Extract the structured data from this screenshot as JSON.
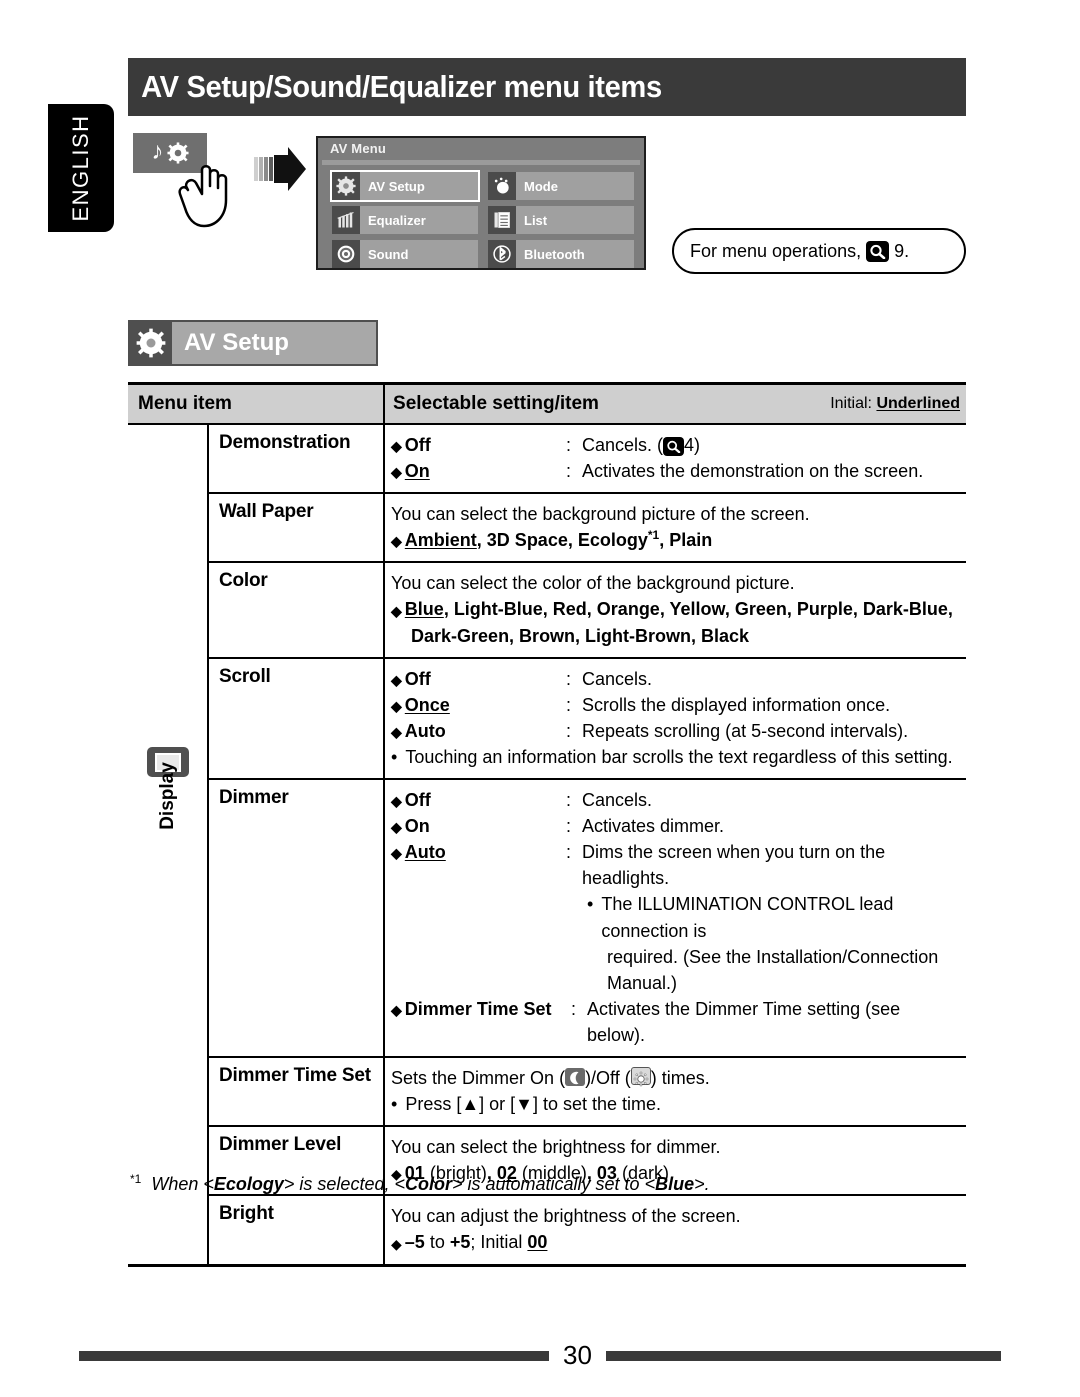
{
  "language_tab": "ENGLISH",
  "page_title": "AV Setup/Sound/Equalizer menu items",
  "source_icon": {
    "name": "music-gear-icon"
  },
  "av_menu_panel": {
    "title": "AV Menu",
    "buttons": [
      {
        "label": "AV Setup",
        "icon": "gear-icon",
        "selected": true
      },
      {
        "label": "Mode",
        "icon": "mode-icon",
        "selected": false
      },
      {
        "label": "Equalizer",
        "icon": "equalizer-icon",
        "selected": false
      },
      {
        "label": "List",
        "icon": "list-icon",
        "selected": false
      },
      {
        "label": "Sound",
        "icon": "sound-disc-icon",
        "selected": false
      },
      {
        "label": "Bluetooth",
        "icon": "bluetooth-icon",
        "selected": false
      }
    ]
  },
  "callout": {
    "text_before": "For menu operations,",
    "icon": "magnifier-icon",
    "text_after": "9."
  },
  "section": {
    "icon": "gear-icon",
    "title": "AV Setup"
  },
  "table": {
    "headers": {
      "menu_item": "Menu item",
      "selectable": "Selectable setting/item",
      "initial_prefix": "Initial:",
      "initial_underlined": "Underlined"
    },
    "category": {
      "label": "Display",
      "icon": "display-screen-icon"
    },
    "rows": [
      {
        "item": "Demonstration",
        "options": [
          {
            "name": "Off",
            "underlined": false,
            "desc_pre": "Cancels. (",
            "icon": "magnifier-icon",
            "desc_post": "4)"
          },
          {
            "name": "On",
            "underlined": true,
            "desc": "Activates the demonstration on the screen."
          }
        ]
      },
      {
        "item": "Wall Paper",
        "intro": "You can select the background picture of the screen.",
        "list_line": "Ambient, 3D Space, Ecology*1, Plain",
        "list_initial": "Ambient"
      },
      {
        "item": "Color",
        "intro": "You can select the color of the background picture.",
        "list_line_1": "Blue, Light-Blue, Red, Orange, Yellow, Green, Purple, Dark-Blue,",
        "list_line_2": "Dark-Green, Brown, Light-Brown, Black",
        "list_initial": "Blue"
      },
      {
        "item": "Scroll",
        "options": [
          {
            "name": "Off",
            "underlined": false,
            "desc": "Cancels."
          },
          {
            "name": "Once",
            "underlined": true,
            "desc": "Scrolls the displayed information once."
          },
          {
            "name": "Auto",
            "underlined": false,
            "desc": "Repeats scrolling (at 5-second intervals)."
          }
        ],
        "note": "Touching an information bar scrolls the text regardless of this setting."
      },
      {
        "item": "Dimmer",
        "options": [
          {
            "name": "Off",
            "underlined": false,
            "desc": "Cancels."
          },
          {
            "name": "On",
            "underlined": false,
            "desc": "Activates dimmer."
          },
          {
            "name": "Auto",
            "underlined": true,
            "desc": "Dims the screen when you turn on the headlights."
          }
        ],
        "sub_note_line_1": "The ILLUMINATION CONTROL lead connection is",
        "sub_note_line_2": "required. (See the Installation/Connection Manual.)",
        "last_option": {
          "name": "Dimmer Time Set",
          "desc": "Activates the Dimmer Time setting (see below)."
        }
      },
      {
        "item": "Dimmer Time Set",
        "line_a_1": "Sets the Dimmer On (",
        "line_a_icon_on": "moon-icon",
        "line_a_2": ")/Off (",
        "line_a_icon_off": "sun-icon",
        "line_a_3": ") times.",
        "note": "Press [▲] or [▼] to set the time."
      },
      {
        "item": "Dimmer Level",
        "intro": "You can select the brightness for dimmer.",
        "values": "01 (bright), 02 (middle), 03 (dark)",
        "initial": "02"
      },
      {
        "item": "Bright",
        "intro": "You can adjust the brightness of the screen.",
        "values": "–5 to +5; Initial 00",
        "initial": "00"
      }
    ]
  },
  "footnote": {
    "marker": "*1",
    "text": "When <Ecology> is selected, <Color> is automatically set to <Blue>."
  },
  "footer": {
    "page_number": "30"
  }
}
